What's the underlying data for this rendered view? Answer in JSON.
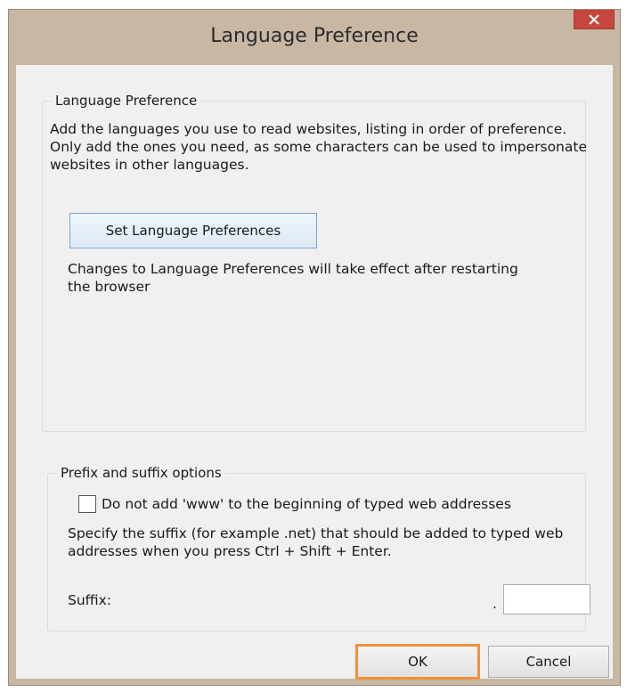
{
  "window": {
    "title": "Language Preference",
    "close_symbol": "×",
    "close_icon": "close-icon"
  },
  "language_group": {
    "legend": "Language Preference",
    "description": "Add the languages you use to read websites, listing in order of preference. Only add the ones you need, as some characters can be used to impersonate websites in other languages.",
    "set_button_label": "Set Language Preferences",
    "note": "Changes to Language Preferences will take effect after restarting the browser"
  },
  "prefix_group": {
    "legend": "Prefix and suffix options",
    "checkbox_label": "Do not add 'www' to the beginning of typed web addresses",
    "checkbox_checked": false,
    "suffix_description": "Specify the suffix (for example .net) that should be added to typed web addresses when you press Ctrl + Shift + Enter.",
    "suffix_label": "Suffix:",
    "suffix_dot": ".",
    "suffix_value": ""
  },
  "buttons": {
    "ok_label": "OK",
    "cancel_label": "Cancel",
    "highlight_color": "#f0913b"
  }
}
